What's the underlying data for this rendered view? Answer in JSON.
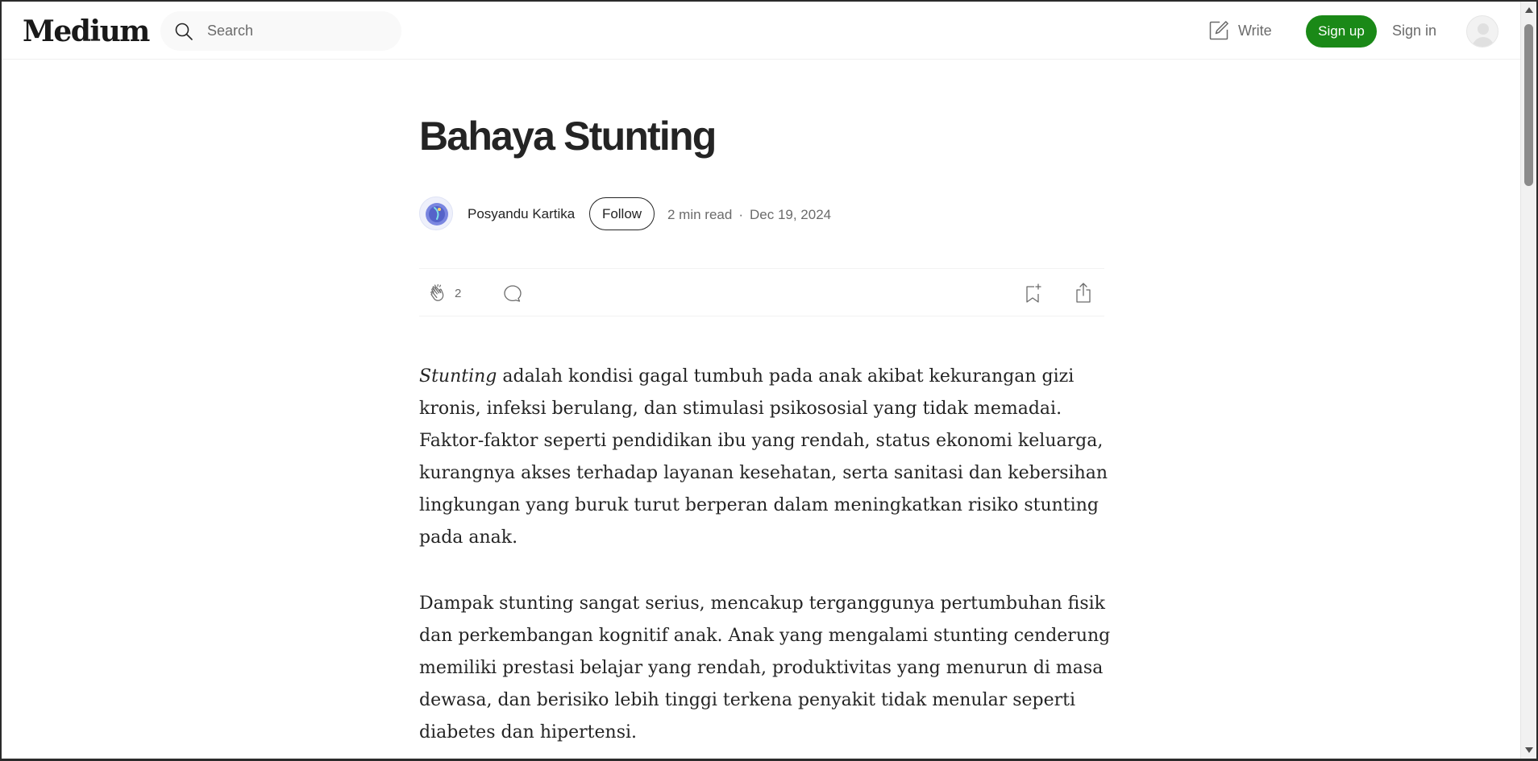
{
  "header": {
    "logo": "Medium",
    "search_placeholder": "Search",
    "write_label": "Write",
    "signup_label": "Sign up",
    "signin_label": "Sign in"
  },
  "article": {
    "title": "Bahaya Stunting",
    "author": "Posyandu Kartika",
    "follow_label": "Follow",
    "read_time": "2 min read",
    "separator": "·",
    "date": "Dec 19, 2024",
    "clap_count": "2",
    "paragraphs": [
      {
        "lead_italic": "Stunting",
        "text": " adalah kondisi gagal tumbuh pada anak akibat kekurangan gizi kronis, infeksi berulang, dan stimulasi psikososial yang tidak memadai. Faktor-faktor seperti pendidikan ibu yang rendah, status ekonomi keluarga, kurangnya akses terhadap layanan kesehatan, serta sanitasi dan kebersihan lingkungan yang buruk turut berperan dalam meningkatkan risiko stunting pada anak."
      },
      {
        "lead_italic": "",
        "text": "Dampak stunting sangat serius, mencakup terganggunya pertumbuhan fisik dan perkembangan kognitif anak. Anak yang mengalami stunting cenderung memiliki prestasi belajar yang rendah, produktivitas yang menurun di masa dewasa, dan berisiko lebih tinggi terkena penyakit tidak menular seperti diabetes dan hipertensi."
      }
    ]
  },
  "icons": {
    "search": "search-icon",
    "write": "pencil-square-icon",
    "clap": "clap-icon",
    "comment": "comment-bubble-icon",
    "bookmark": "bookmark-add-icon",
    "share": "share-icon",
    "avatar": "user-avatar-icon"
  },
  "colors": {
    "brand_green": "#1a8917",
    "text": "#242424",
    "muted": "#6b6b6b",
    "search_bg": "#f9f9f9"
  }
}
